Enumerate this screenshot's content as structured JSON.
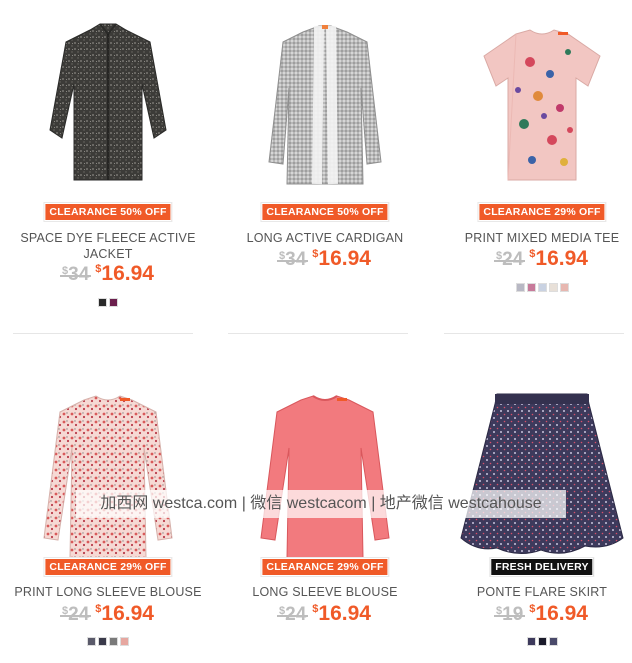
{
  "products": [
    {
      "badge": "CLEARANCE 50% OFF",
      "badge_style": "orange",
      "title": "SPACE DYE FLEECE ACTIVE JACKET",
      "old_price": "34",
      "new_price": "16.94",
      "currency": "$",
      "swatches": [
        "#2a2a2a",
        "#6b1f4d"
      ],
      "icon": "fleece-jacket-image"
    },
    {
      "badge": "CLEARANCE 50% OFF",
      "badge_style": "orange",
      "title": "LONG ACTIVE CARDIGAN",
      "old_price": "34",
      "new_price": "16.94",
      "currency": "$",
      "swatches": [],
      "icon": "cardigan-image"
    },
    {
      "badge": "CLEARANCE 29% OFF",
      "badge_style": "orange",
      "title": "PRINT MIXED MEDIA TEE",
      "old_price": "24",
      "new_price": "16.94",
      "currency": "$",
      "swatches": [
        "#b8b8c4",
        "#c77a9a",
        "#c9d2e2",
        "#e8e0d8",
        "#e7b7b0"
      ],
      "icon": "floral-tee-image"
    },
    {
      "badge": "CLEARANCE 29% OFF",
      "badge_style": "orange",
      "title": "PRINT LONG SLEEVE BLOUSE",
      "old_price": "24",
      "new_price": "16.94",
      "currency": "$",
      "swatches": [
        "#5a5a6a",
        "#3a3a4a",
        "#7a7a7a",
        "#e6a7a0"
      ],
      "icon": "print-blouse-image"
    },
    {
      "badge": "CLEARANCE 29% OFF",
      "badge_style": "orange",
      "title": "LONG SLEEVE BLOUSE",
      "old_price": "24",
      "new_price": "16.94",
      "currency": "$",
      "swatches": [],
      "icon": "pink-blouse-image"
    },
    {
      "badge": "FRESH DELIVERY",
      "badge_style": "dark",
      "title": "PONTE FLARE SKIRT",
      "old_price": "19",
      "new_price": "16.94",
      "currency": "$",
      "swatches": [
        "#3d3a5c",
        "#1a1a2a",
        "#4a4a6a"
      ],
      "icon": "flare-skirt-image"
    }
  ],
  "watermark": "加西网 westca.com | 微信 westcacom | 地产微信 westcahouse"
}
